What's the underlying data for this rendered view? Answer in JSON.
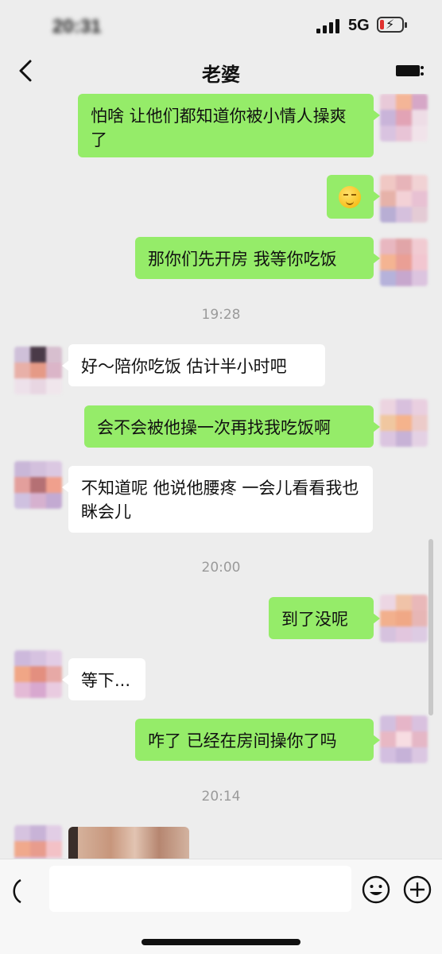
{
  "status_bar": {
    "time": "20:31",
    "network": "5G"
  },
  "header": {
    "title": "老婆"
  },
  "messages": [
    {
      "side": "me",
      "text": "怕啥 让他们都知道你被小情人操爽了"
    },
    {
      "side": "me",
      "emoji": "smiling-face-emoji"
    },
    {
      "side": "me",
      "text": "那你们先开房 我等你吃饭"
    },
    {
      "timestamp": "19:28"
    },
    {
      "side": "other",
      "text": "好～陪你吃饭 估计半小时吧"
    },
    {
      "side": "me",
      "text": "会不会被他操一次再找我吃饭啊"
    },
    {
      "side": "other",
      "text": "不知道呢 他说他腰疼 一会儿看看我也眯会儿"
    },
    {
      "timestamp": "20:00"
    },
    {
      "side": "me",
      "text": "到了没呢"
    },
    {
      "side": "other",
      "text": "等下..."
    },
    {
      "side": "me",
      "text": "咋了 已经在房间操你了吗"
    },
    {
      "timestamp": "20:14"
    },
    {
      "side": "other",
      "image": "photo-message"
    }
  ],
  "icons": {
    "back": "chevron-left-icon",
    "more": "more-icon",
    "voice": "voice-icon",
    "emoji": "emoji-icon",
    "plus": "plus-icon"
  },
  "colors": {
    "my_bubble": "#95ec69",
    "their_bubble": "#ffffff",
    "background": "#ededed"
  },
  "input": {
    "value": "",
    "placeholder": ""
  }
}
